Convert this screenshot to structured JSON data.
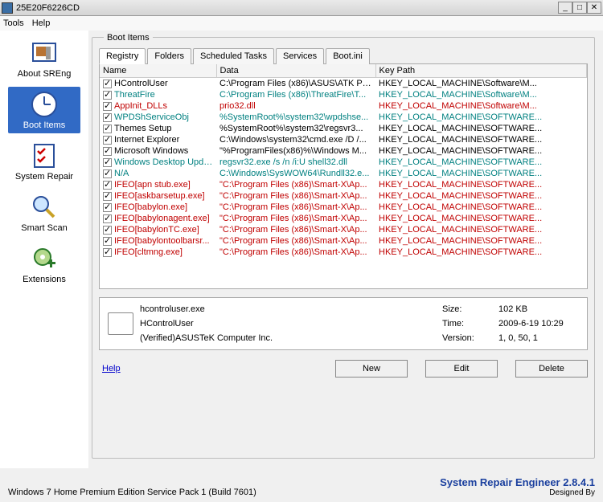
{
  "window": {
    "title": "25E20F6226CD"
  },
  "menu": {
    "tools": "Tools",
    "help": "Help"
  },
  "sidebar": {
    "items": [
      {
        "label": "About SREng"
      },
      {
        "label": "Boot Items"
      },
      {
        "label": "System Repair"
      },
      {
        "label": "Smart Scan"
      },
      {
        "label": "Extensions"
      }
    ]
  },
  "group": {
    "title": "Boot Items"
  },
  "tabs": [
    {
      "label": "Registry"
    },
    {
      "label": "Folders"
    },
    {
      "label": "Scheduled Tasks"
    },
    {
      "label": "Services"
    },
    {
      "label": "Boot.ini"
    }
  ],
  "columns": {
    "name": "Name",
    "data": "Data",
    "keypath": "Key Path"
  },
  "rows": [
    {
      "c": "#000",
      "name": "HControlUser",
      "data": "C:\\Program Files (x86)\\ASUS\\ATK Pa...",
      "key": "HKEY_LOCAL_MACHINE\\Software\\M..."
    },
    {
      "c": "#008080",
      "name": "ThreatFire",
      "data": "C:\\Program Files (x86)\\ThreatFire\\T...",
      "key": "HKEY_LOCAL_MACHINE\\Software\\M..."
    },
    {
      "c": "#c00000",
      "name": "AppInit_DLLs",
      "data": "prio32.dll",
      "key": "HKEY_LOCAL_MACHINE\\Software\\M..."
    },
    {
      "c": "#008080",
      "name": "WPDShServiceObj",
      "data": "%SystemRoot%\\system32\\wpdshse...",
      "key": "HKEY_LOCAL_MACHINE\\SOFTWARE..."
    },
    {
      "c": "#000",
      "name": "Themes Setup",
      "data": "%SystemRoot%\\system32\\regsvr3...",
      "key": "HKEY_LOCAL_MACHINE\\SOFTWARE..."
    },
    {
      "c": "#000",
      "name": "Internet Explorer",
      "data": "C:\\Windows\\system32\\cmd.exe /D /...",
      "key": "HKEY_LOCAL_MACHINE\\SOFTWARE..."
    },
    {
      "c": "#000",
      "name": "Microsoft Windows",
      "data": "\"%ProgramFiles(x86)%\\Windows M...",
      "key": "HKEY_LOCAL_MACHINE\\SOFTWARE..."
    },
    {
      "c": "#008080",
      "name": "Windows Desktop Update",
      "data": "regsvr32.exe /s /n /i:U shell32.dll",
      "key": "HKEY_LOCAL_MACHINE\\SOFTWARE..."
    },
    {
      "c": "#008080",
      "name": "N/A",
      "data": "C:\\Windows\\SysWOW64\\Rundll32.e...",
      "key": "HKEY_LOCAL_MACHINE\\SOFTWARE..."
    },
    {
      "c": "#c00000",
      "name": "IFEO[apn stub.exe]",
      "data": "\"C:\\Program Files (x86)\\Smart-X\\Ap...",
      "key": "HKEY_LOCAL_MACHINE\\SOFTWARE..."
    },
    {
      "c": "#c00000",
      "name": "IFEO[askbarsetup.exe]",
      "data": "\"C:\\Program Files (x86)\\Smart-X\\Ap...",
      "key": "HKEY_LOCAL_MACHINE\\SOFTWARE..."
    },
    {
      "c": "#c00000",
      "name": "IFEO[babylon.exe]",
      "data": "\"C:\\Program Files (x86)\\Smart-X\\Ap...",
      "key": "HKEY_LOCAL_MACHINE\\SOFTWARE..."
    },
    {
      "c": "#c00000",
      "name": "IFEO[babylonagent.exe]",
      "data": "\"C:\\Program Files (x86)\\Smart-X\\Ap...",
      "key": "HKEY_LOCAL_MACHINE\\SOFTWARE..."
    },
    {
      "c": "#c00000",
      "name": "IFEO[babylonTC.exe]",
      "data": "\"C:\\Program Files (x86)\\Smart-X\\Ap...",
      "key": "HKEY_LOCAL_MACHINE\\SOFTWARE..."
    },
    {
      "c": "#c00000",
      "name": "IFEO[babylontoolbarsr...",
      "data": "\"C:\\Program Files (x86)\\Smart-X\\Ap...",
      "key": "HKEY_LOCAL_MACHINE\\SOFTWARE..."
    },
    {
      "c": "#c00000",
      "name": "IFEO[cltmng.exe]",
      "data": "\"C:\\Program Files (x86)\\Smart-X\\Ap...",
      "key": "HKEY_LOCAL_MACHINE\\SOFTWARE..."
    }
  ],
  "detail": {
    "filename": "hcontroluser.exe",
    "desc": "HControlUser",
    "publisher": "(Verified)ASUSTeK Computer Inc.",
    "size_label": "Size:",
    "size_value": "102 KB",
    "time_label": "Time:",
    "time_value": "2009-6-19 10:29",
    "version_label": "Version:",
    "version_value": "1, 0, 50, 1"
  },
  "buttons": {
    "help": "Help",
    "new": "New",
    "edit": "Edit",
    "delete": "Delete"
  },
  "status": {
    "os": "Windows 7 Home Premium Edition Service Pack 1 (Build 7601)",
    "app": "System Repair Engineer 2.8.4.1",
    "designed": "Designed By"
  }
}
